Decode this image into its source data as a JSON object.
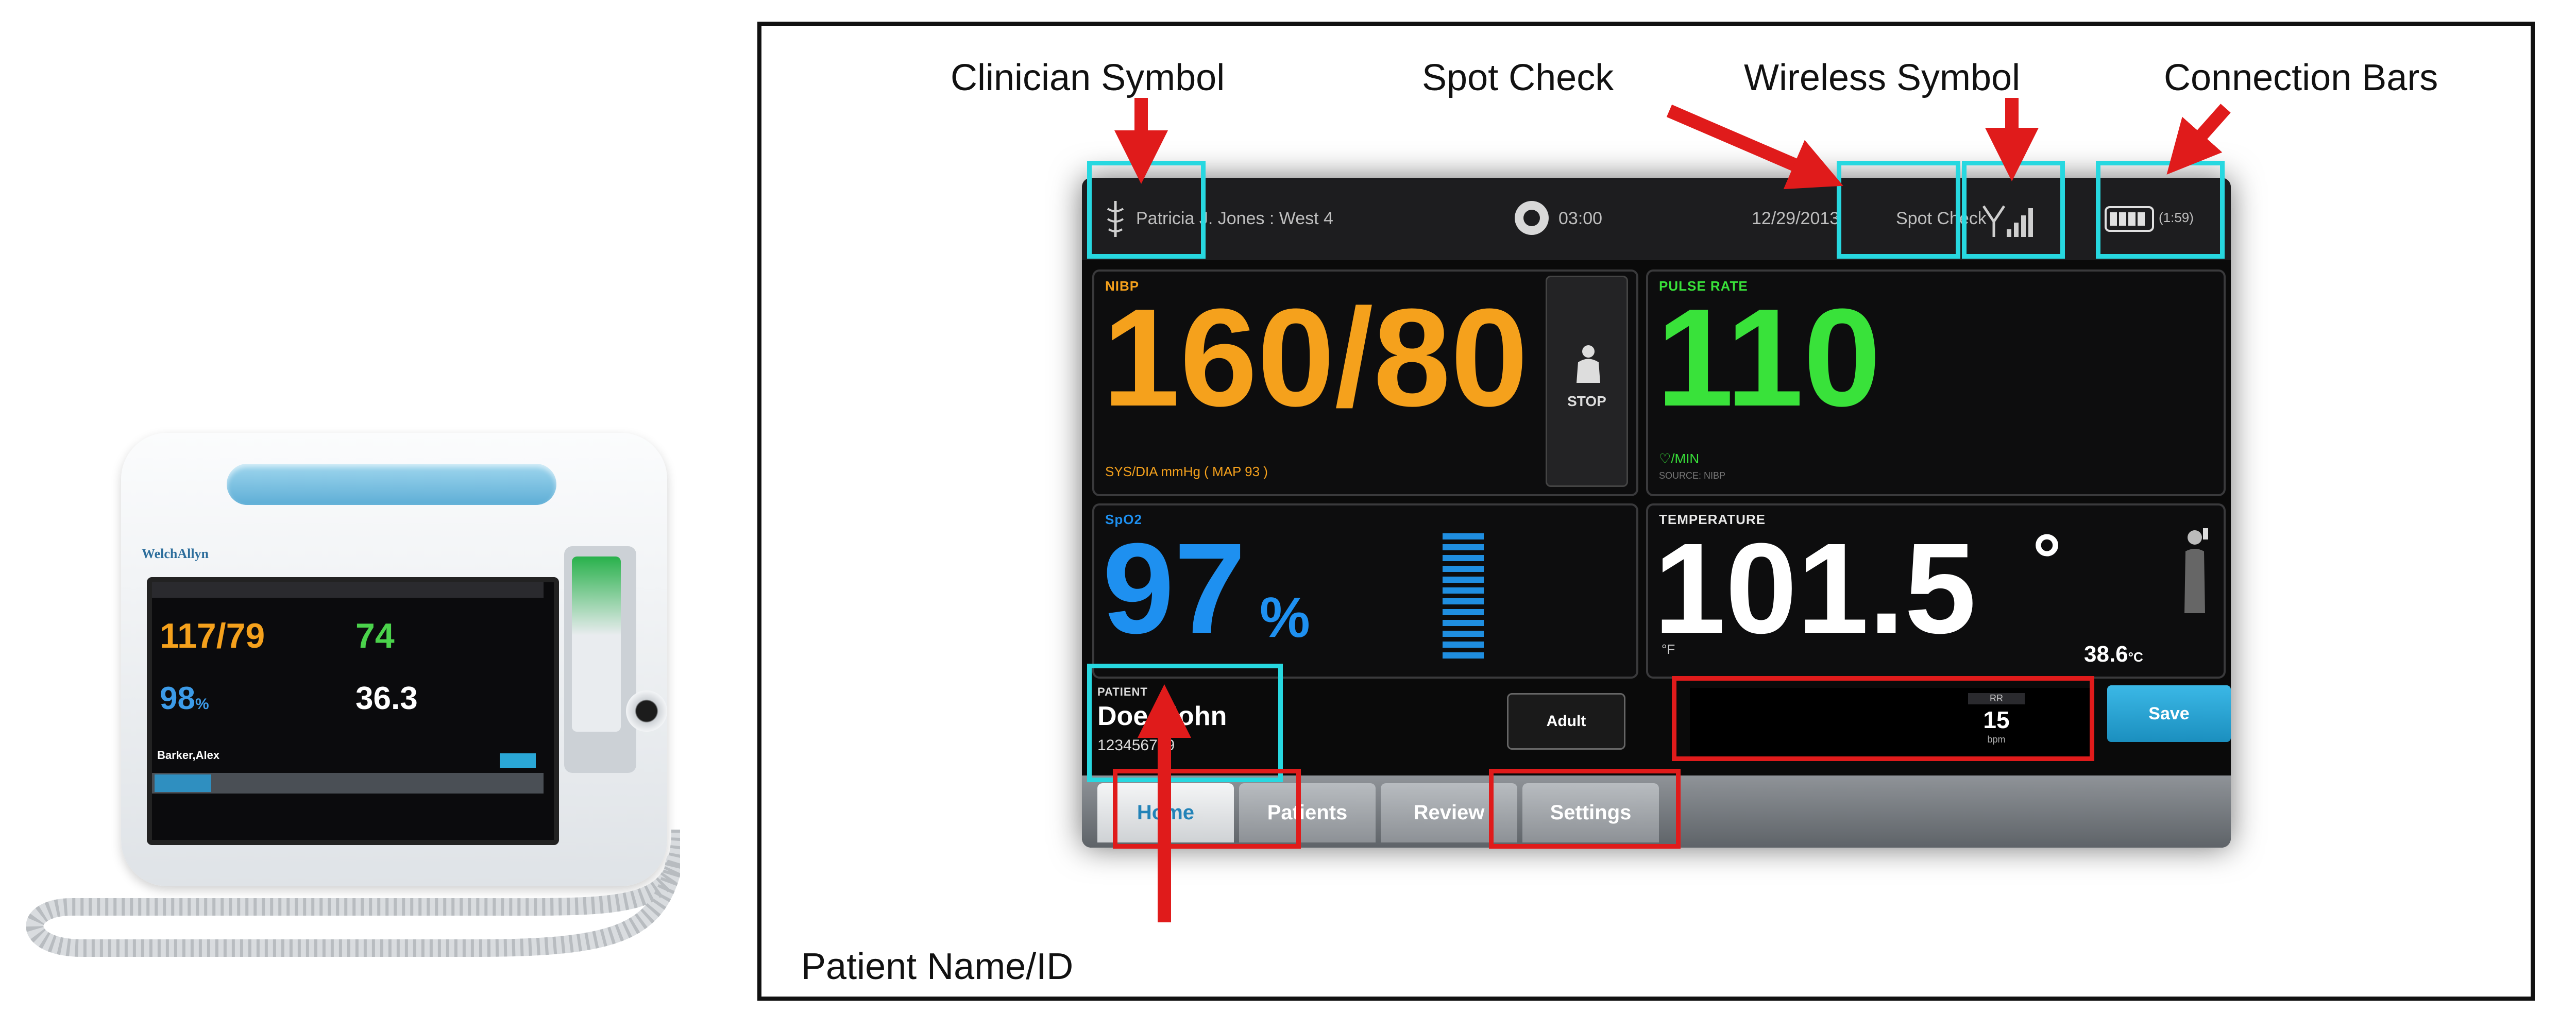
{
  "device_photo": {
    "brand": "WelchAllyn",
    "bp": "117/79",
    "pulse": "74",
    "spo2": "98",
    "spo2_unit": "%",
    "temp": "36.3",
    "patient": "Barker,Alex"
  },
  "callouts": {
    "clinician_symbol": "Clinician Symbol",
    "spot_check": "Spot Check",
    "wireless_symbol": "Wireless Symbol",
    "connection_bars": "Connection Bars",
    "patient_name_id": "Patient Name/ID"
  },
  "monitor": {
    "topbar": {
      "clinician": "Patricia J. Jones : West 4",
      "timer": "03:00",
      "date": "12/29/2013",
      "mode": "Spot Check",
      "battery_time": "(1:59)"
    },
    "nibp": {
      "label": "NIBP",
      "value": "160/80",
      "sub": "SYS/DIA mmHg ( MAP 93 )",
      "stop_label": "STOP"
    },
    "pulse": {
      "label": "PULSE RATE",
      "value": "110",
      "unit": "♡/MIN",
      "source": "SOURCE: NIBP"
    },
    "spo2": {
      "label": "SpO2",
      "value": "97",
      "unit": "%"
    },
    "temperature": {
      "label": "TEMPERATURE",
      "value": "101.5",
      "degree": "°",
      "unit_f": "°F",
      "celsius": "38.6",
      "celsius_unit": "°C"
    },
    "patient": {
      "label": "PATIENT",
      "name": "Doe, John",
      "id": "123456789"
    },
    "adult_button": "Adult",
    "rr": {
      "label": "RR",
      "value": "15",
      "unit": "bpm"
    },
    "save_button": "Save",
    "tabs": [
      "Home",
      "Patients",
      "Review",
      "Settings"
    ]
  },
  "colors": {
    "nibp": "#f5a11c",
    "pulse": "#39e23a",
    "spo2": "#1e90f0",
    "highlight_cyan": "#27d8e0",
    "highlight_red": "#e01b1b"
  }
}
